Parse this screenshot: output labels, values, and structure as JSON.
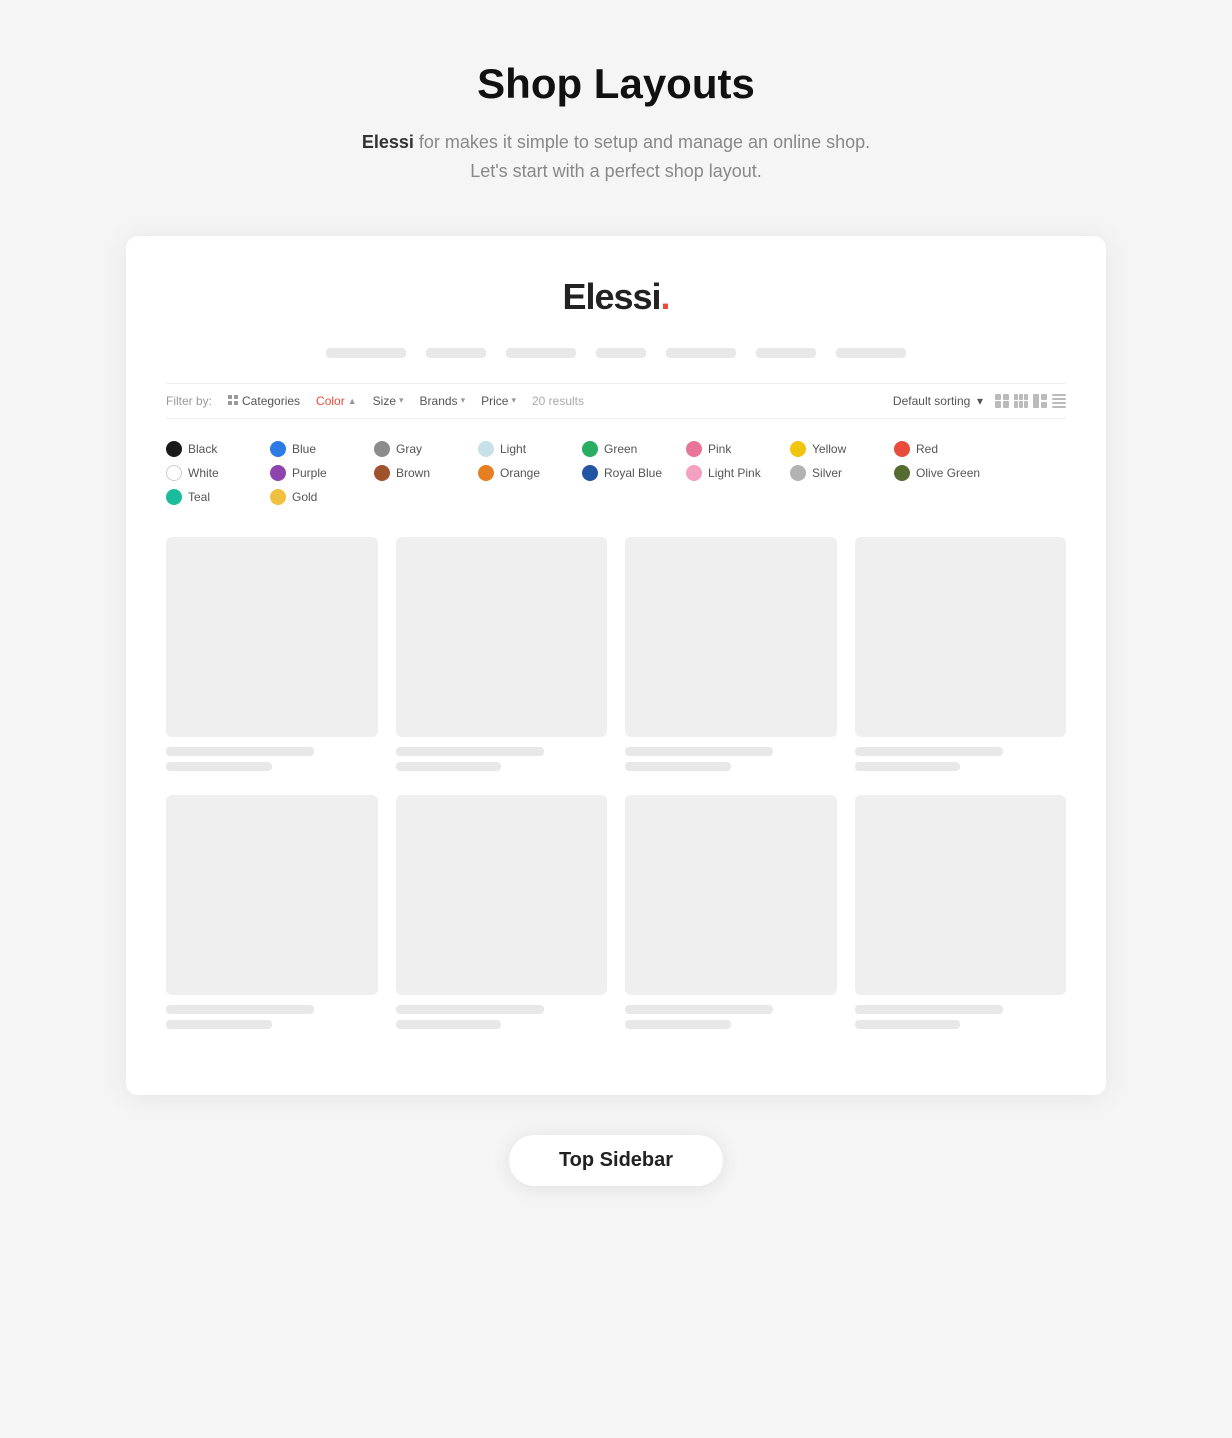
{
  "header": {
    "title": "Shop Layouts",
    "subtitle_brand": "Elessi",
    "subtitle_text": " for makes it simple to setup and manage an online shop.\nLet's start with a perfect shop layout."
  },
  "preview": {
    "logo": "Elessi",
    "logo_dot": ".",
    "nav_bars": [
      80,
      60,
      70,
      50,
      70,
      60,
      70
    ],
    "filter": {
      "label": "Filter by:",
      "items": [
        {
          "label": "Categories",
          "active": false,
          "hasChevron": false
        },
        {
          "label": "Color",
          "active": true,
          "hasChevron": true
        },
        {
          "label": "Size",
          "active": false,
          "hasChevron": true
        },
        {
          "label": "Brands",
          "active": false,
          "hasChevron": true
        },
        {
          "label": "Price",
          "active": false,
          "hasChevron": true
        }
      ],
      "results": "20 results",
      "sort_label": "Default sorting"
    },
    "colors": [
      {
        "name": "Black",
        "hex": "#1a1a1a"
      },
      {
        "name": "Blue",
        "hex": "#2c7be5"
      },
      {
        "name": "Gray",
        "hex": "#8c8c8c"
      },
      {
        "name": "Light",
        "hex": "#c8e0e8"
      },
      {
        "name": "Green",
        "hex": "#27ae60"
      },
      {
        "name": "Pink",
        "hex": "#e9749a"
      },
      {
        "name": "Yellow",
        "hex": "#f1c40f"
      },
      {
        "name": "Red",
        "hex": "#e74c3c"
      },
      {
        "name": "White",
        "hex": "#ffffff",
        "bordered": true
      },
      {
        "name": "Purple",
        "hex": "#8e44ad"
      },
      {
        "name": "Brown",
        "hex": "#a0522d"
      },
      {
        "name": "Orange",
        "hex": "#e67e22"
      },
      {
        "name": "Royal Blue",
        "hex": "#2155a3"
      },
      {
        "name": "Light Pink",
        "hex": "#f4a0c0"
      },
      {
        "name": "Silver",
        "hex": "#b2b2b2"
      },
      {
        "name": "Olive Green",
        "hex": "#556b2f"
      },
      {
        "name": "Teal",
        "hex": "#1abc9c"
      },
      {
        "name": "Gold",
        "hex": "#f0c040"
      }
    ],
    "layout_label": "Top Sidebar"
  }
}
